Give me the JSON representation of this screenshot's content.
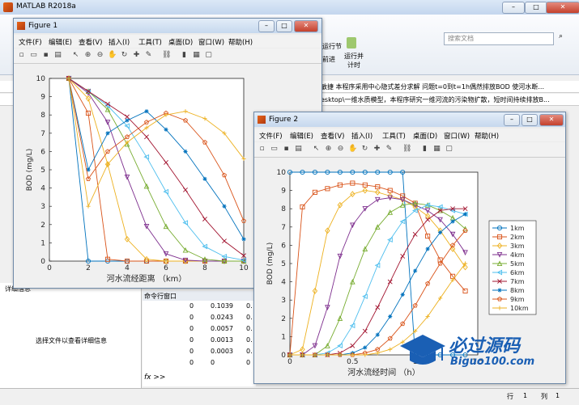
{
  "matlab": {
    "title": "MATLAB R2018a",
    "search_placeholder": "搜索文档",
    "ribbon_run_section": "运行节",
    "ribbon_advance": "前进",
    "ribbon_run_time": "运行并\n计时",
    "cmd_text1": "敏捷 本程序采用中心隐式差分求解 问题t=0到t=1h偶然排放BOD 使河水断...",
    "cmd_text2": "esktop\\一维水质模型，本程序研究一维河流的污染物扩散，短时间持续排放B...",
    "detail_label": "详细信息",
    "detail_hint": "选择文件以查看详细信息",
    "cmdwin_label": "命令行窗口",
    "cmd_rows": [
      [
        "0",
        "0.1039",
        "0."
      ],
      [
        "0",
        "0.0243",
        "0."
      ],
      [
        "0",
        "0.0057",
        "0."
      ],
      [
        "0",
        "0.0013",
        "0."
      ],
      [
        "0",
        "0.0003",
        "0."
      ],
      [
        "0",
        "0",
        "0"
      ]
    ],
    "fx_prompt": "fx >>",
    "status_row_label": "行",
    "status_row": "1",
    "status_col_label": "列",
    "status_col": "1"
  },
  "figure1": {
    "title": "Figure 1",
    "menus": [
      "文件(F)",
      "编辑(E)",
      "查看(V)",
      "插入(I)",
      "工具(T)",
      "桌面(D)",
      "窗口(W)",
      "帮助(H)"
    ]
  },
  "figure2": {
    "title": "Figure 2",
    "menus": [
      "文件(F)",
      "编辑(E)",
      "查看(V)",
      "插入(I)",
      "工具(T)",
      "桌面(D)",
      "窗口(W)",
      "帮助(H)"
    ]
  },
  "watermark": {
    "cn": "必过源码",
    "en": "Biguo100.com"
  },
  "colors": {
    "s1": "#0072BD",
    "s2": "#D95319",
    "s3": "#EDB120",
    "s4": "#7E2F8E",
    "s5": "#77AC30",
    "s6": "#4DBEEE",
    "s7": "#A2142F",
    "s8": "#0072BD",
    "s9": "#D95319",
    "s10": "#EDB120"
  },
  "chart_data": [
    {
      "type": "line",
      "xlabel": "河水流经距离 （km）",
      "ylabel": "BOD (mg/L)",
      "xlim": [
        0,
        10
      ],
      "ylim": [
        0,
        10
      ],
      "xticks": [
        0,
        2,
        4,
        6,
        8,
        10
      ],
      "yticks": [
        0,
        1,
        2,
        3,
        4,
        5,
        6,
        7,
        8,
        9,
        10
      ],
      "x": [
        1,
        2,
        3,
        4,
        5,
        6,
        7,
        8,
        9,
        10
      ],
      "series": [
        {
          "values": [
            10,
            0,
            0,
            0,
            0,
            0,
            0,
            0,
            0,
            0
          ],
          "marker": "o"
        },
        {
          "values": [
            10,
            8.1,
            0.1,
            0,
            0,
            0,
            0,
            0,
            0,
            0
          ],
          "marker": "s"
        },
        {
          "values": [
            10,
            8.9,
            5.3,
            1.2,
            0.1,
            0,
            0,
            0,
            0,
            0
          ],
          "marker": "d"
        },
        {
          "values": [
            10,
            9.2,
            7.6,
            4.6,
            1.9,
            0.4,
            0.05,
            0,
            0,
            0
          ],
          "marker": "v"
        },
        {
          "values": [
            10,
            9.3,
            8.3,
            6.4,
            4.1,
            1.9,
            0.6,
            0.1,
            0,
            0
          ],
          "marker": "^"
        },
        {
          "values": [
            10,
            9.3,
            8.5,
            7.4,
            5.7,
            3.8,
            2.1,
            0.8,
            0.25,
            0.05
          ],
          "marker": "<"
        },
        {
          "values": [
            10,
            9.3,
            8.6,
            7.9,
            6.8,
            5.4,
            3.9,
            2.3,
            1.1,
            0.3
          ],
          "marker": "x"
        },
        {
          "values": [
            10,
            5.0,
            7.0,
            7.7,
            8.2,
            7.2,
            6.0,
            4.5,
            3.0,
            1.2
          ],
          "marker": "*"
        },
        {
          "values": [
            10,
            4.5,
            6.0,
            6.8,
            7.6,
            8.1,
            7.7,
            6.5,
            4.7,
            2.2
          ],
          "marker": "p"
        },
        {
          "values": [
            10,
            3.0,
            5.3,
            6.5,
            7.3,
            8.0,
            8.2,
            7.8,
            7.0,
            5.6
          ],
          "marker": "+"
        }
      ]
    },
    {
      "type": "line",
      "xlabel": "河水流经时间 （h）",
      "ylabel": "BOD (mg/L)",
      "xlim": [
        0,
        1.5
      ],
      "ylim": [
        0,
        10
      ],
      "xticks": [
        0,
        0.5,
        1,
        1.5
      ],
      "yticks": [
        0,
        1,
        2,
        3,
        4,
        5,
        6,
        7,
        8,
        9,
        10
      ],
      "x": [
        0,
        0.1,
        0.2,
        0.3,
        0.4,
        0.5,
        0.6,
        0.7,
        0.8,
        0.9,
        1.0,
        1.1,
        1.2,
        1.3,
        1.4
      ],
      "legend": [
        "1km",
        "2km",
        "3km",
        "4km",
        "5km",
        "6km",
        "7km",
        "8km",
        "9km",
        "10km"
      ],
      "legend_position": "right",
      "series": [
        {
          "name": "1km",
          "marker": "o",
          "values": [
            10,
            10,
            10,
            10,
            10,
            10,
            10,
            10,
            10,
            10,
            0,
            0,
            0,
            0,
            0
          ]
        },
        {
          "name": "2km",
          "marker": "s",
          "values": [
            0,
            8.1,
            8.9,
            9.1,
            9.3,
            9.4,
            9.3,
            9.2,
            9.0,
            8.7,
            8.3,
            6.5,
            5.2,
            4.3,
            3.5
          ]
        },
        {
          "name": "3km",
          "marker": "d",
          "values": [
            0,
            0.3,
            3.5,
            6.8,
            8.2,
            8.8,
            9.0,
            8.9,
            8.7,
            8.5,
            8.1,
            7.6,
            6.8,
            5.8,
            4.8
          ]
        },
        {
          "name": "4km",
          "marker": "v",
          "values": [
            0,
            0,
            0.5,
            2.6,
            5.4,
            7.1,
            8.0,
            8.5,
            8.6,
            8.5,
            8.2,
            7.9,
            7.4,
            6.6,
            5.6
          ]
        },
        {
          "name": "5km",
          "marker": "^",
          "values": [
            0,
            0,
            0,
            0.5,
            2.0,
            4.0,
            5.8,
            7.0,
            7.8,
            8.2,
            8.3,
            8.2,
            7.9,
            7.5,
            6.9
          ]
        },
        {
          "name": "6km",
          "marker": "<",
          "values": [
            0,
            0,
            0,
            0.1,
            0.5,
            1.6,
            3.2,
            4.9,
            6.3,
            7.3,
            7.9,
            8.2,
            8.1,
            7.9,
            7.7
          ]
        },
        {
          "name": "7km",
          "marker": "x",
          "values": [
            0,
            0,
            0,
            0,
            0.1,
            0.5,
            1.3,
            2.6,
            4.0,
            5.4,
            6.6,
            7.4,
            7.9,
            8.0,
            8.0
          ]
        },
        {
          "name": "8km",
          "marker": "*",
          "values": [
            0,
            0,
            0,
            0,
            0,
            0.1,
            0.4,
            1.1,
            2.1,
            3.3,
            4.6,
            5.8,
            6.7,
            7.3,
            7.7
          ]
        },
        {
          "name": "9km",
          "marker": "p",
          "values": [
            0,
            0,
            0,
            0,
            0,
            0,
            0.1,
            0.3,
            0.9,
            1.7,
            2.7,
            3.9,
            5.0,
            6.0,
            6.8
          ]
        },
        {
          "name": "10km",
          "marker": "+",
          "values": [
            0,
            0,
            0,
            0,
            0,
            0,
            0,
            0.1,
            0.3,
            0.7,
            1.3,
            2.1,
            3.1,
            4.1,
            5.0
          ]
        }
      ]
    }
  ]
}
